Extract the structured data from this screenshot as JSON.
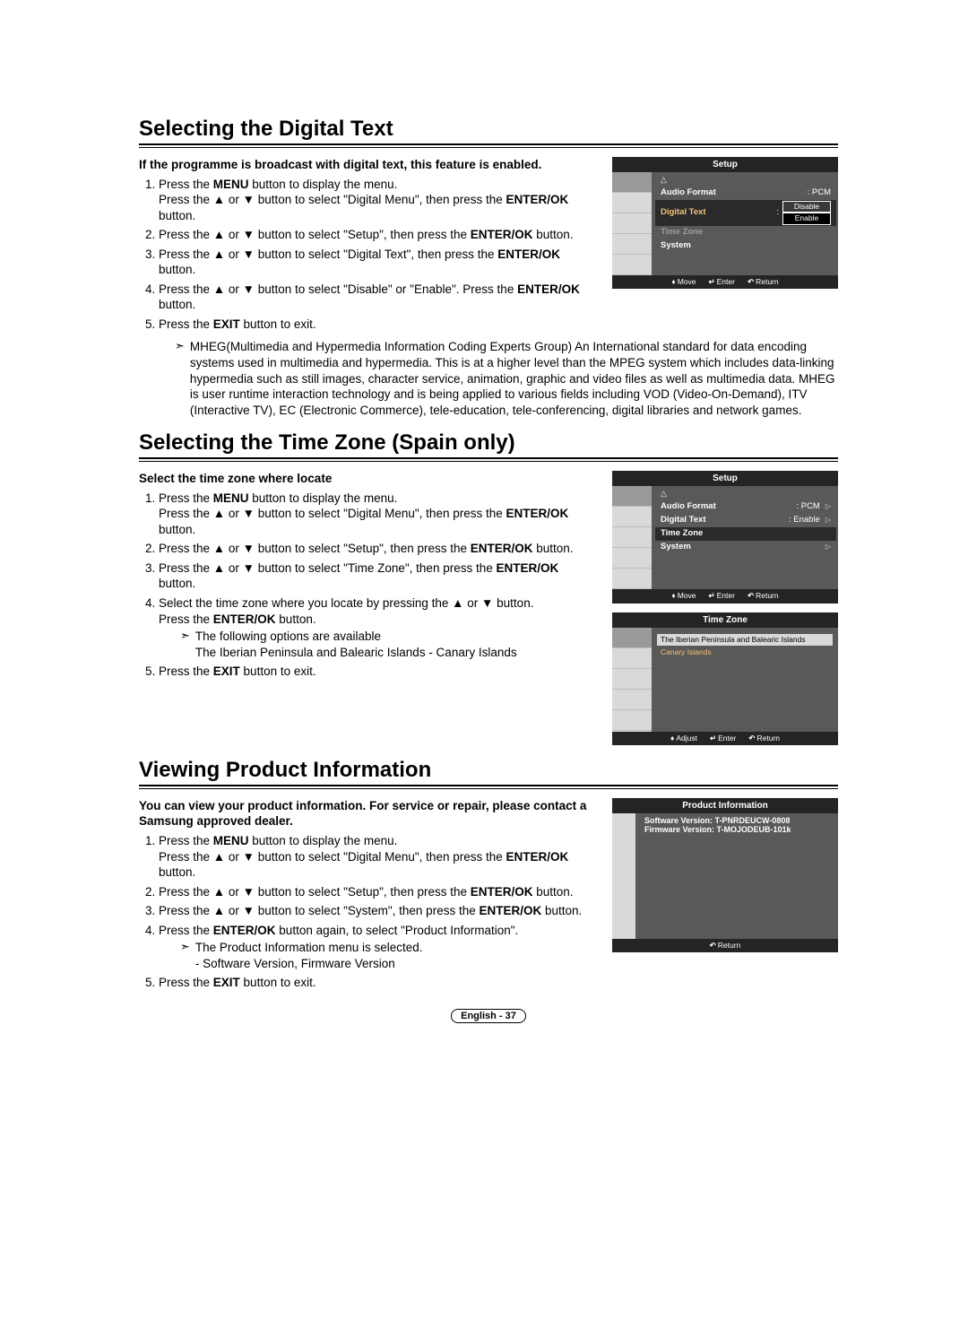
{
  "page": {
    "number_label": "English - 37"
  },
  "sections": [
    {
      "title": "Selecting the Digital Text",
      "intro": "If the programme is broadcast with digital text, this feature is enabled.",
      "steps": [
        "Press the MENU button to display the menu. Press the ▲ or ▼ button to select \"Digital Menu\", then press the ENTER/OK button.",
        "Press the ▲ or ▼ button to select \"Setup\", then press the ENTER/OK button.",
        "Press the ▲ or ▼ button to select \"Digital Text\", then press the ENTER/OK button.",
        "Press the ▲ or ▼ button to select \"Disable\" or \"Enable\". Press the ENTER/OK button.",
        "Press the EXIT button to exit."
      ],
      "long_note": "MHEG(Multimedia and Hypermedia Information Coding Experts Group) An International standard for data encoding systems used in multimedia and hypermedia. This is at a higher level than the MPEG system which includes data-linking hypermedia such as still images, character service, animation, graphic and video files as well as multimedia data. MHEG is user runtime interaction technology and is being applied to various fields including VOD (Video-On-Demand), ITV (Interactive TV), EC (Electronic Commerce), tele-education, tele-conferencing, digital libraries and network games."
    },
    {
      "title": "Selecting the Time Zone (Spain only)",
      "intro": "Select the time zone where locate",
      "steps": [
        "Press the MENU button to display the menu. Press the ▲ or ▼ button to select \"Digital Menu\", then press the ENTER/OK button.",
        "Press the ▲ or ▼ button to select \"Setup\", then press the ENTER/OK button.",
        "Press the ▲ or ▼ button to select \"Time Zone\", then press the ENTER/OK button.",
        "Select the time zone where you locate by pressing the ▲ or ▼ button. Press the ENTER/OK button.",
        "Press the EXIT button to exit."
      ],
      "sub_note_lead": "The following options are available",
      "sub_note_body": "The Iberian Peninsula and Balearic Islands  - Canary Islands"
    },
    {
      "title": "Viewing Product Information",
      "intro": "You can view your product information. For service or repair, please contact a Samsung approved dealer.",
      "steps": [
        "Press the MENU button to display the menu. Press the ▲ or ▼ button to select \"Digital Menu\", then press the ENTER/OK button.",
        "Press the ▲ or ▼ button to select \"Setup\", then press the ENTER/OK button.",
        "Press the ▲ or ▼ button to select \"System\", then press the ENTER/OK button.",
        "Press the ENTER/OK button again, to select \"Product Information\".",
        "Press the EXIT button to exit."
      ],
      "sub_note_lead": "The Product Information menu is selected.",
      "sub_note_body": "- Software Version, Firmware Version"
    }
  ],
  "tv": {
    "setup_title": "Setup",
    "timezone_title": "Time Zone",
    "prodinfo_title": "Product Information",
    "menu1": {
      "rows": [
        {
          "label": "Audio Format",
          "value": ": PCM"
        },
        {
          "label": "Digital Text",
          "value": ":",
          "dropdown": [
            "Disable",
            "Enable"
          ],
          "selected": 1,
          "hi": true
        },
        {
          "label": "Time Zone",
          "value": "",
          "dim": true
        },
        {
          "label": "System",
          "value": ""
        }
      ]
    },
    "menu2": {
      "rows": [
        {
          "label": "Audio Format",
          "value": ": PCM",
          "tri": true
        },
        {
          "label": "Digital Text",
          "value": ": Enable",
          "tri": true
        },
        {
          "label": "Time Zone",
          "value": "",
          "hi": true
        },
        {
          "label": "System",
          "value": "",
          "tri": true
        }
      ]
    },
    "tz": {
      "options": [
        "The Iberian Peninsula and Balearic Islands",
        "Canary Islands"
      ],
      "selected": 0
    },
    "prod": {
      "lines": [
        "Software Version: T-PNRDEUCW-0808",
        "Firmware Version: T-MOJODEUB-101k"
      ]
    },
    "footer": {
      "move": "Move",
      "adjust": "Adjust",
      "enter": "Enter",
      "return": "Return",
      "move_sym": "♦",
      "enter_sym": "↵",
      "return_sym": "↶"
    }
  }
}
